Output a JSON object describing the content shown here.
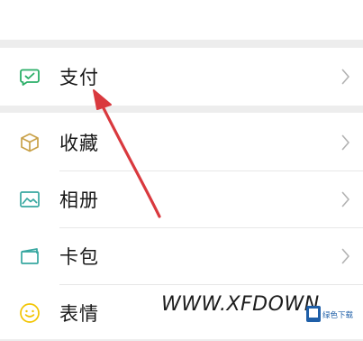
{
  "menu": {
    "pay": {
      "label": "支付",
      "icon": "pay-icon"
    },
    "favorites": {
      "label": "收藏",
      "icon": "favorites-cube-icon"
    },
    "album": {
      "label": "相册",
      "icon": "album-picture-icon"
    },
    "cards": {
      "label": "卡包",
      "icon": "card-wallet-icon"
    },
    "stickers": {
      "label": "表情",
      "icon": "smiley-face-icon"
    }
  },
  "watermark": {
    "text": "WWW.XFDOWN",
    "badge": "绿色下载"
  },
  "colors": {
    "background": "#ededed",
    "card": "#ffffff",
    "pay_icon": "#2aae67",
    "icon_teal": "#37a7a0",
    "sticker_icon": "#f2c400",
    "chevron": "#b2b2b2",
    "annotation_arrow": "#d9393e"
  }
}
